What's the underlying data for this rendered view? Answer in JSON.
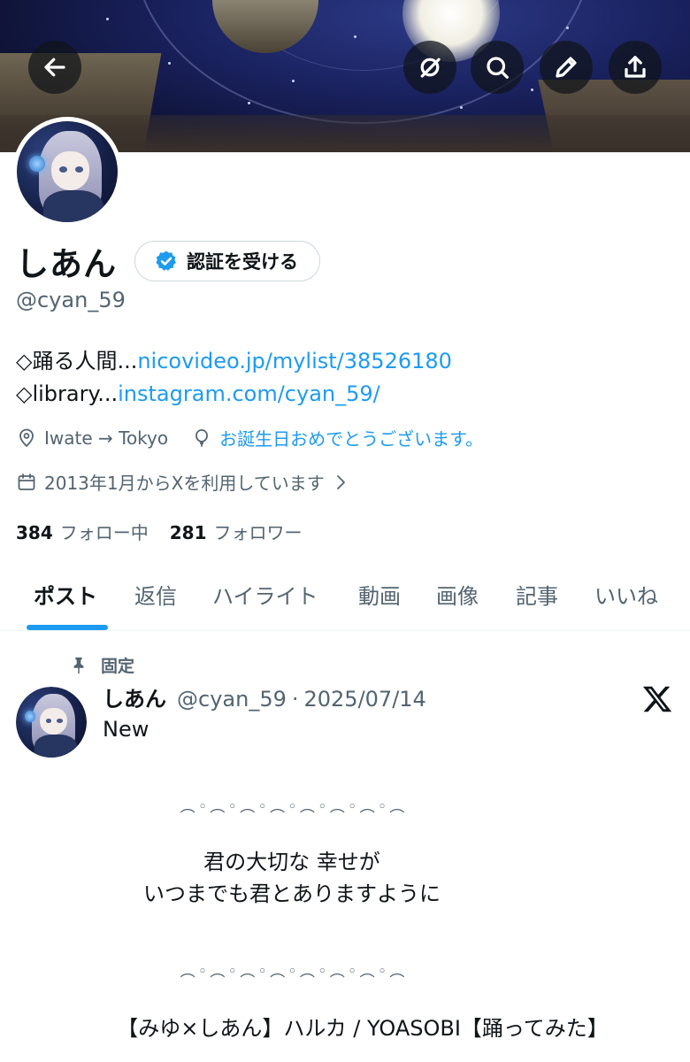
{
  "header": {
    "back_icon": "back-arrow-icon",
    "actions": [
      "grok-icon",
      "search-icon",
      "edit-icon",
      "share-icon"
    ]
  },
  "profile": {
    "display_name": "しあん",
    "verify_button": "認証を受ける",
    "handle": "@cyan_59",
    "bio": {
      "line1_prefix": "◇踊る人間...",
      "line1_link": "nicovideo.jp/mylist/38526180",
      "line2_prefix": "◇library...",
      "line2_link": "instagram.com/cyan_59/"
    },
    "location": "Iwate → Tokyo",
    "birthday": "お誕生日おめでとうございます。",
    "joined": "2013年1月からXを利用しています",
    "following_count": "384",
    "following_label": "フォロー中",
    "followers_count": "281",
    "followers_label": "フォロワー"
  },
  "tabs": [
    {
      "label": "ポスト",
      "active": true
    },
    {
      "label": "返信"
    },
    {
      "label": "ハイライト"
    },
    {
      "label": "動画"
    },
    {
      "label": "画像"
    },
    {
      "label": "記事"
    },
    {
      "label": "いいね"
    }
  ],
  "pinned_post": {
    "pinned_label": "固定",
    "author_name": "しあん",
    "author_handle": "@cyan_59",
    "separator": "·",
    "date": "2025/07/14",
    "text_first": "New",
    "deco_line": "︵ ◦ ︵ ◦ ︵ ◦ ︵ ◦ ︵ ◦ ︵ ◦ ︵ ◦ ︵",
    "verse_line1": "君の大切な 幸せが",
    "verse_line2": "いつまでも君とありますように",
    "title_line": "【みゆ×しあん】ハルカ / YOASOBI【踊ってみた】"
  },
  "colors": {
    "accent": "#1d9bf0",
    "secondary_text": "#536471",
    "primary_text": "#0f1419"
  }
}
